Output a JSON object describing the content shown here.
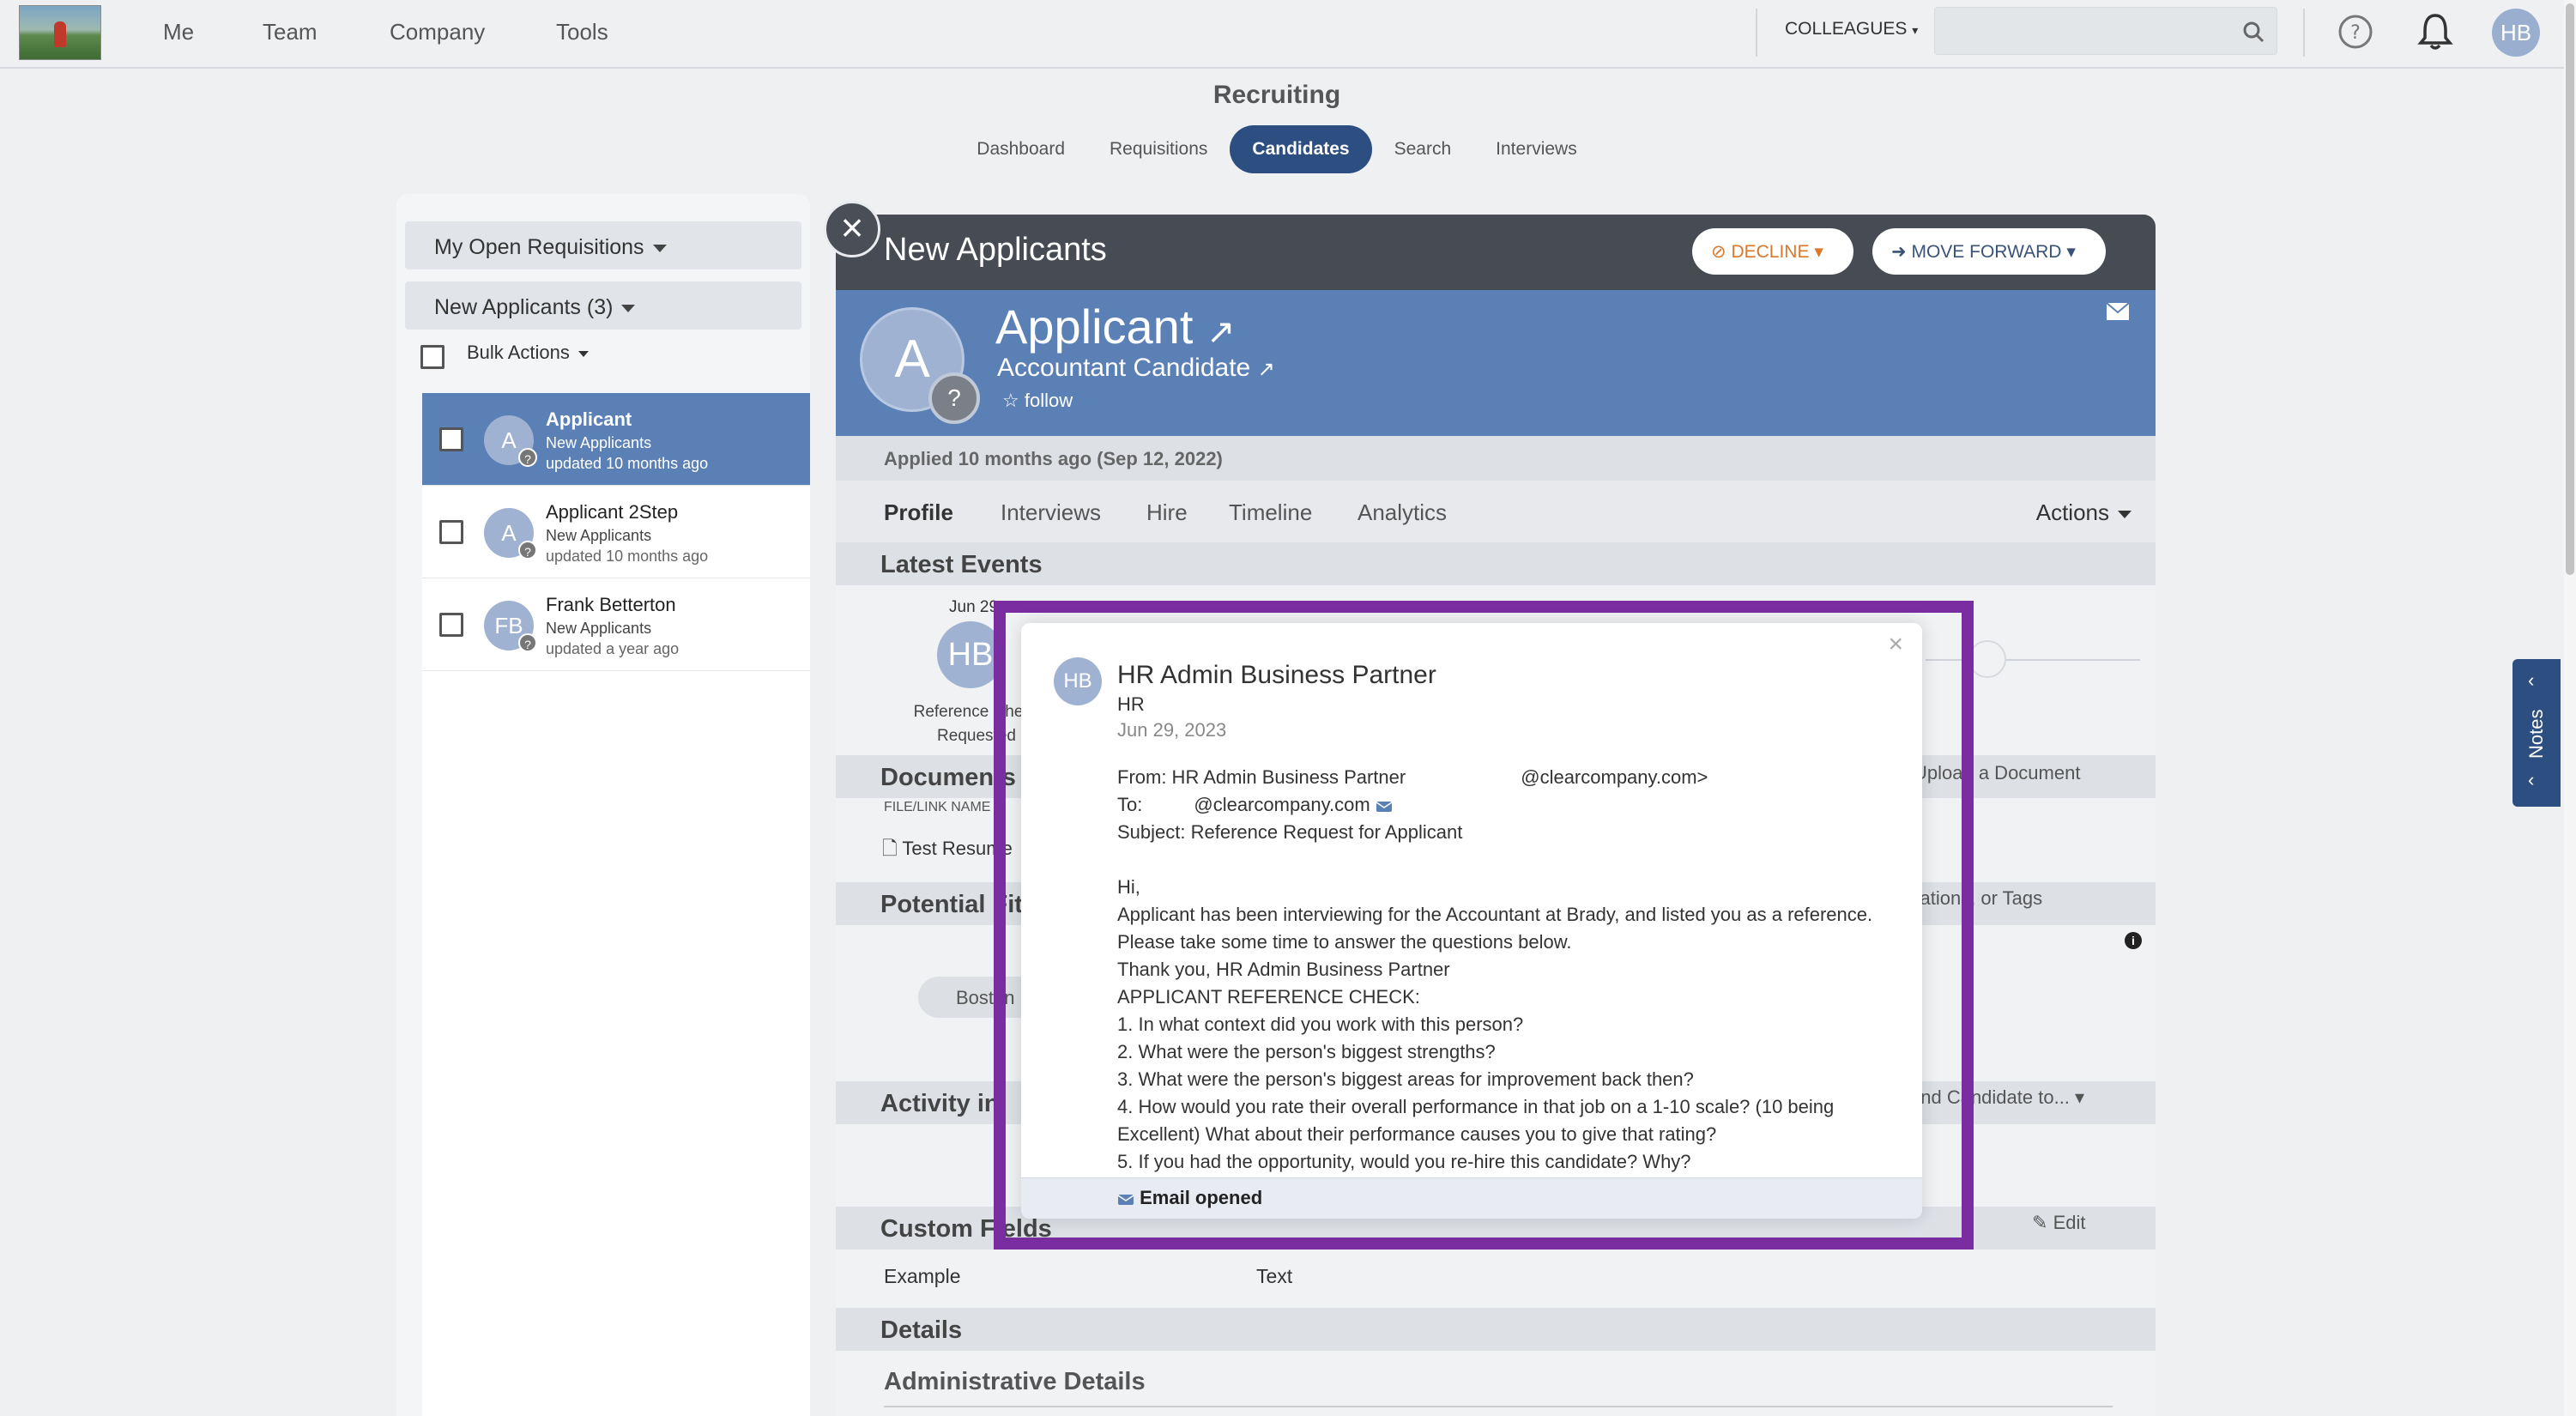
{
  "topnav": {
    "items": [
      "Me",
      "Team",
      "Company",
      "Tools"
    ],
    "colleagues": "COLLEAGUES",
    "search_placeholder": "",
    "user_initials": "HB"
  },
  "recruiting": {
    "title": "Recruiting",
    "tabs": [
      "Dashboard",
      "Requisitions",
      "Candidates",
      "Search",
      "Interviews"
    ],
    "active_tab": "Candidates"
  },
  "left": {
    "requisition_filter": "My Open Requisitions",
    "stage_filter": "New Applicants (3)",
    "bulk_actions": "Bulk Actions",
    "candidates": [
      {
        "initials": "A",
        "name": "Applicant",
        "stage": "New Applicants",
        "updated": "updated 10 months ago",
        "badge": "?"
      },
      {
        "initials": "A",
        "name": "Applicant 2Step",
        "stage": "New Applicants",
        "updated": "updated 10 months ago",
        "badge": "?"
      },
      {
        "initials": "FB",
        "name": "Frank Betterton",
        "stage": "New Applicants",
        "updated": "updated a year ago",
        "badge": "?"
      }
    ]
  },
  "main": {
    "header_title": "New Applicants",
    "close": "×",
    "decline": "DECLINE",
    "move_forward": "MOVE FORWARD",
    "candidate": {
      "initials": "A",
      "badge": "?",
      "name": "Applicant",
      "position": "Accountant Candidate",
      "follow": "follow"
    },
    "applied": "Applied 10 months ago (Sep 12, 2022)",
    "subtabs": [
      "Profile",
      "Interviews",
      "Hire",
      "Timeline",
      "Analytics"
    ],
    "actions": "Actions",
    "sections": {
      "latest_events": "Latest Events",
      "documents": "Documents",
      "upload": "Upload a Document",
      "file_link_name": "FILE/LINK NAME",
      "test_resume": "Test Resume",
      "potential_fits": "Potential Fits",
      "potential_hint": "Locations, or Tags",
      "boston": "Boston",
      "activity": "Activity in",
      "send_to": "end Candidate to...",
      "custom_fields": "Custom Fields",
      "edit": "Edit",
      "example": "Example",
      "example_value": "Text",
      "details": "Details",
      "admin_details": "Administrative Details"
    },
    "event": {
      "date": "Jun 29",
      "initials": "HB",
      "label": "Reference Check Requested"
    }
  },
  "popup": {
    "close": "×",
    "initials": "HB",
    "sender": "HR Admin Business Partner",
    "dept": "HR",
    "date": "Jun 29, 2023",
    "from": "From: HR Admin Business Partner",
    "from_email": "@clearcompany.com>",
    "to": "To:",
    "to_email": "@clearcompany.com",
    "subject": "Subject: Reference Request for Applicant",
    "greeting": "Hi,",
    "line1": "Applicant has been interviewing for the Accountant at Brady, and listed you as a reference. Please take some time to answer the questions below.",
    "line2": "Thank you, HR Admin Business Partner",
    "line3": "APPLICANT REFERENCE CHECK:",
    "q1": "1. In what context did you work with this person?",
    "q2": "2. What were the person's biggest strengths?",
    "q3": "3. What were the person's biggest areas for improvement back then?",
    "q4": "4. How would you rate their overall performance in that job on a 1-10 scale? (10 being Excellent) What about their performance causes you to give that rating?",
    "q5": "5. If you had the opportunity, would you re-hire this candidate? Why?",
    "status": "Email opened"
  },
  "notes_tab": "Notes"
}
